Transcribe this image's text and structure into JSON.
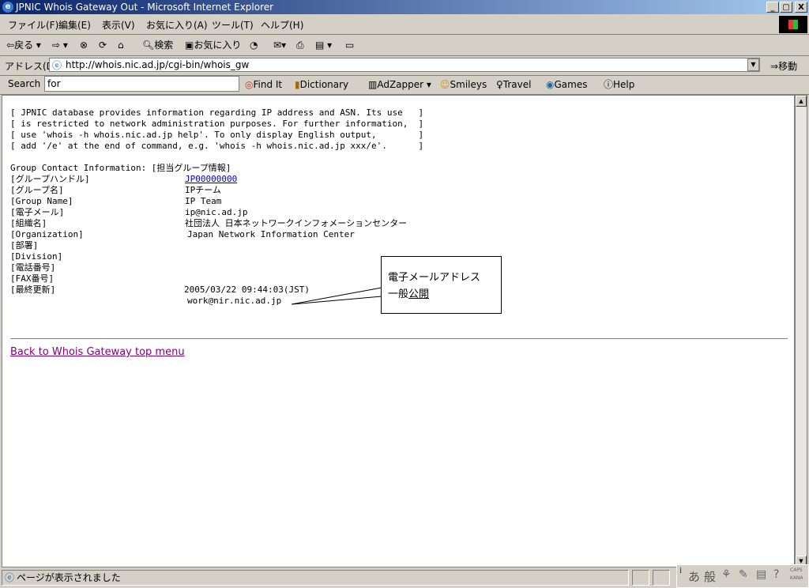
{
  "window": {
    "title": "JPNIC Whois Gateway Out - Microsoft Internet Explorer",
    "min": "_",
    "max": "▢",
    "close": "X"
  },
  "menubar": {
    "items": [
      "ファイル(F)",
      "編集(E)",
      "表示(V)",
      "お気に入り(A)",
      "ツール(T)",
      "ヘルプ(H)"
    ]
  },
  "toolbar": {
    "back": "戻る",
    "search": "検索",
    "favorites": "お気に入り"
  },
  "address": {
    "label": "アドレス(D)",
    "url": "http://whois.nic.ad.jp/cgi-bin/whois_gw",
    "go": "移動"
  },
  "searchbar": {
    "label": "Search",
    "value": "for",
    "find_it": "Find It",
    "dictionary": "Dictionary",
    "adzapper": "AdZapper",
    "smileys": "Smileys",
    "travel": "Travel",
    "games": "Games",
    "help": "Help"
  },
  "page": {
    "notice": [
      "[ JPNIC database provides information regarding IP address and ASN. Its use   ]",
      "[ is restricted to network administration purposes. For further information,  ]",
      "[ use 'whois -h whois.nic.ad.jp help'. To only display English output,        ]",
      "[ add '/e' at the end of command, e.g. 'whois -h whois.nic.ad.jp xxx/e'.      ]"
    ],
    "section_header": "Group Contact Information: [担当グループ情報]",
    "labels": [
      "[グループハンドル]",
      "[グループ名]",
      "[Group Name]",
      "[電子メール]",
      "[組織名]",
      "[Organization]",
      "[部署]",
      "[Division]",
      "[電話番号]",
      "[FAX番号]",
      "[最終更新]"
    ],
    "values": {
      "handle": "JP00000000",
      "group_name_ja": "IPチーム",
      "group_name_en": "IP Team",
      "email": "ip@nic.ad.jp",
      "org_ja": "社団法人 日本ネットワークインフォメーションセンター",
      "org_en": "Japan Network Information Center",
      "updated": "2005/03/22 09:44:03(JST)",
      "extra_email": "work@nir.nic.ad.jp"
    },
    "back_link": "Back to Whois Gateway top menu"
  },
  "callout": {
    "line1": "電子メールアドレス",
    "line2_a": "一般",
    "line2_b": "公開"
  },
  "status": {
    "text": "ページが表示されました",
    "ime_a": "あ",
    "ime_b": "般",
    "caps": "CAPS",
    "kana": "KANA"
  },
  "colors": {
    "title_start": "#0a246a",
    "title_end": "#a6caf0",
    "link": "#0000cc",
    "visited_link": "#800080"
  }
}
